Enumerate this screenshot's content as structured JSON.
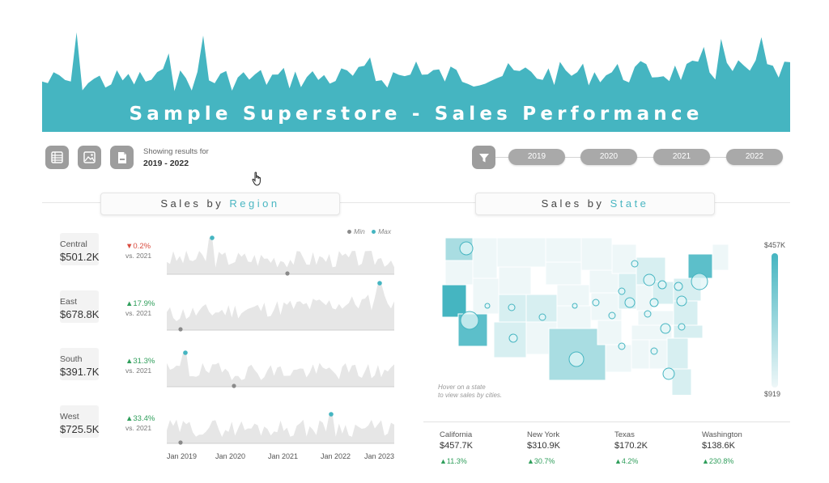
{
  "header": {
    "title": "Sample Superstore - Sales Performance",
    "banner_color": "#45b5c1"
  },
  "toolbar": {
    "icons": [
      "table-icon",
      "image-icon",
      "pdf-icon",
      "filter-icon"
    ],
    "showing_label": "Showing results for",
    "showing_value": "2019 - 2022"
  },
  "years": [
    "2019",
    "2020",
    "2021",
    "2022"
  ],
  "region_panel": {
    "title_prefix": "Sales by",
    "title_accent": "Region",
    "legend_min": "Min",
    "legend_max": "Max",
    "min_color": "#8a8a8a",
    "max_color": "#45b5c1",
    "area_color": "#e6e6e6",
    "x_ticks": [
      "Jan 2019",
      "Jan 2020",
      "Jan 2021",
      "Jan 2022",
      "Jan 2023"
    ],
    "regions": [
      {
        "name": "Central",
        "value": "$501.2K",
        "change": "▼0.2%",
        "direction": "down",
        "vs": "vs. 2021"
      },
      {
        "name": "East",
        "value": "$678.8K",
        "change": "▲17.9%",
        "direction": "up",
        "vs": "vs. 2021"
      },
      {
        "name": "South",
        "value": "$391.7K",
        "change": "▲31.3%",
        "direction": "up",
        "vs": "vs. 2021"
      },
      {
        "name": "West",
        "value": "$725.5K",
        "change": "▲33.4%",
        "direction": "up",
        "vs": "vs. 2021"
      }
    ]
  },
  "state_panel": {
    "title_prefix": "Sales by",
    "title_accent": "State",
    "scale_max": "$457K",
    "scale_min": "$919",
    "hint_line1": "Hover on a state",
    "hint_line2": "to view sales by cities.",
    "top_states": [
      {
        "name": "California",
        "value": "$457.7K",
        "change": "▲11.3%"
      },
      {
        "name": "New York",
        "value": "$310.9K",
        "change": "▲30.7%"
      },
      {
        "name": "Texas",
        "value": "$170.2K",
        "change": "▲4.2%"
      },
      {
        "name": "Washington",
        "value": "$138.6K",
        "change": "▲230.8%"
      }
    ]
  }
}
